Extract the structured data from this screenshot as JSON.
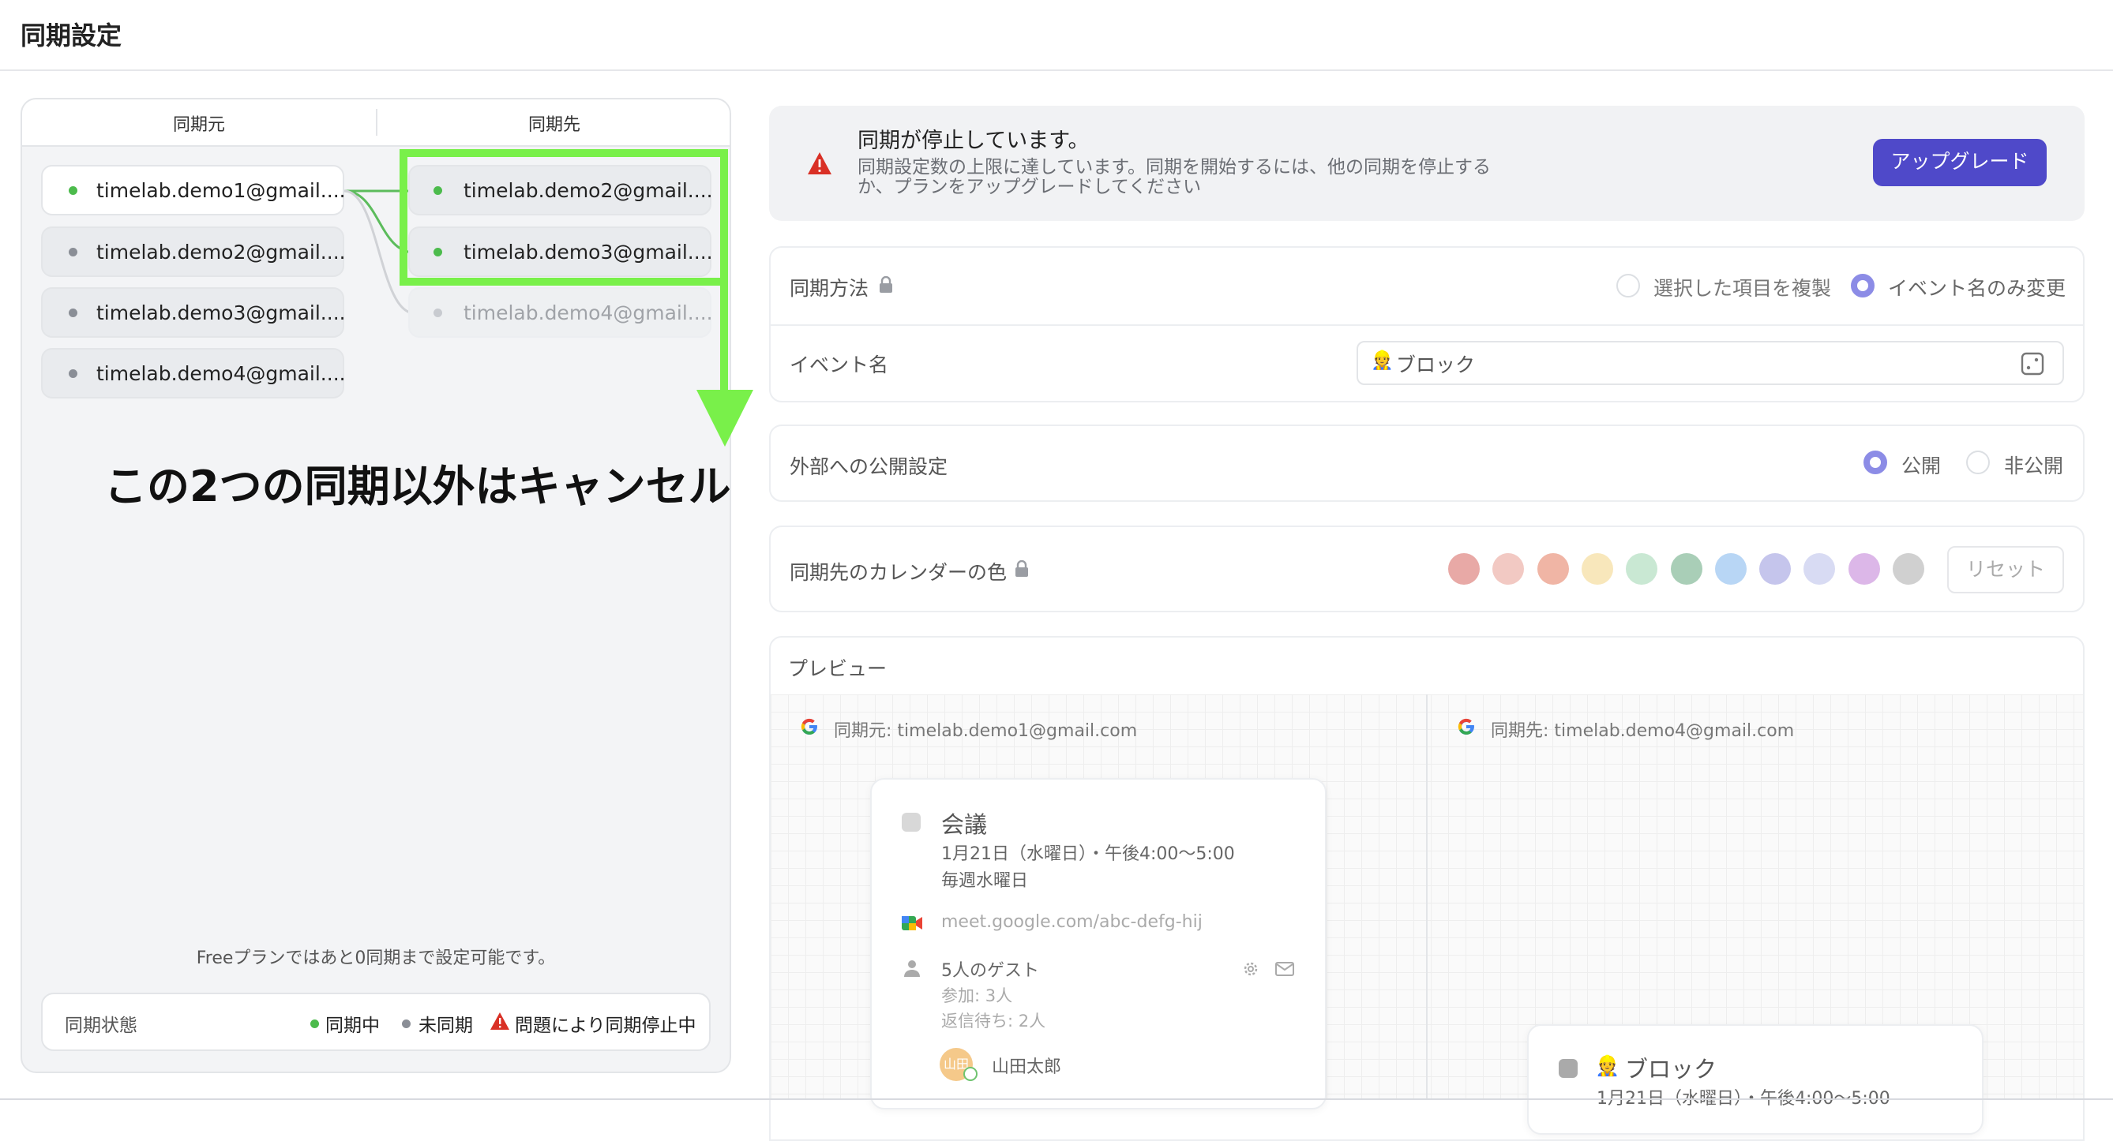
{
  "header": {
    "title": "同期設定"
  },
  "left_panel": {
    "col_source": "同期元",
    "col_target": "同期先",
    "sources": [
      {
        "email": "timelab.demo1@gmail....",
        "status": "green"
      },
      {
        "email": "timelab.demo2@gmail....",
        "status": "gray"
      },
      {
        "email": "timelab.demo3@gmail....",
        "status": "gray"
      },
      {
        "email": "timelab.demo4@gmail....",
        "status": "gray"
      }
    ],
    "targets": [
      {
        "email": "timelab.demo2@gmail....",
        "status": "green"
      },
      {
        "email": "timelab.demo3@gmail....",
        "status": "green"
      },
      {
        "email": "timelab.demo4@gmail....",
        "status": "disabled"
      }
    ],
    "annotation": "この2つの同期以外はキャンセル",
    "plan_note": "Freeプランではあと0同期まで設定可能です。",
    "legend": {
      "title": "同期状態",
      "syncing": "同期中",
      "unsynced": "未同期",
      "stopped": "問題により同期停止中"
    }
  },
  "alert": {
    "title": "同期が停止しています。",
    "message": "同期設定数の上限に達しています。同期を開始するには、他の同期を停止するか、プランをアップグレードしてください",
    "button": "アップグレード"
  },
  "settings": {
    "sync_method": {
      "label": "同期方法",
      "option_copy": "選択した項目を複製",
      "option_rename": "イベント名のみ変更",
      "selected": "option_rename"
    },
    "event_name": {
      "label": "イベント名",
      "value": "ブロック",
      "emoji": "👷"
    },
    "visibility": {
      "label": "外部への公開設定",
      "option_public": "公開",
      "option_private": "非公開",
      "selected": "option_public"
    },
    "calendar_color": {
      "label": "同期先のカレンダーの色",
      "reset": "リセット",
      "swatches": [
        "#e8a9a6",
        "#f2c9c3",
        "#f0b5a5",
        "#f8e7bb",
        "#c9e8d3",
        "#a9ceb7",
        "#b8d6f5",
        "#c5c5ec",
        "#d8dbf3",
        "#dcb7e8",
        "#d0d0d0"
      ]
    }
  },
  "preview": {
    "title": "プレビュー",
    "source_label": "同期元: timelab.demo1@gmail.com",
    "target_label": "同期先: timelab.demo4@gmail.com",
    "event": {
      "title": "会議",
      "datetime": "1月21日（水曜日）・午後4:00～5:00",
      "recurrence": "毎週水曜日",
      "meet": "meet.google.com/abc-defg-hij",
      "guests": "5人のゲスト",
      "attending": "参加: 3人",
      "pending": "返信待ち: 2人",
      "guest1_avatar": "山田",
      "guest1_name": "山田太郎"
    },
    "synced_event": {
      "title": "ブロック",
      "datetime": "1月21日（水曜日）・午後4:00～5:00"
    }
  },
  "colors": {
    "accent": "#4f49c9",
    "highlight": "#79f04a",
    "green": "#4cbb4c",
    "alert_red": "#d93025"
  }
}
